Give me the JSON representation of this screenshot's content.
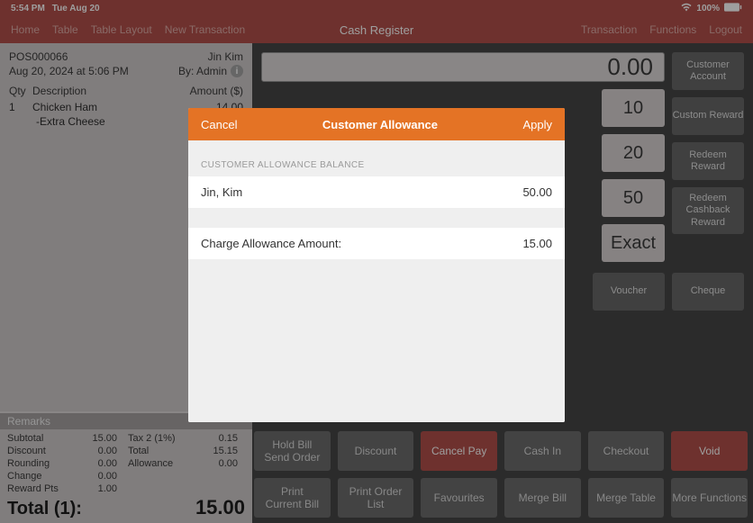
{
  "status": {
    "time": "5:54 PM",
    "date": "Tue Aug 20",
    "battery": "100%"
  },
  "nav": {
    "left": [
      "Home",
      "Table",
      "Table Layout",
      "New Transaction"
    ],
    "title": "Cash Register",
    "right": [
      "Transaction",
      "Functions",
      "Logout"
    ]
  },
  "receipt": {
    "id": "POS000066",
    "customer": "Jin Kim",
    "datetime": "Aug 20, 2024 at 5:06 PM",
    "by": "By: Admin",
    "cols": {
      "qty": "Qty",
      "desc": "Description",
      "amt": "Amount ($)"
    },
    "lines": [
      {
        "qty": "1",
        "desc": "Chicken Ham",
        "amt": "14.00",
        "sub": "-Extra Cheese"
      }
    ],
    "remarks_label": "Remarks",
    "totals": {
      "subtotal_l": "Subtotal",
      "subtotal_v": "15.00",
      "tax2_l": "Tax 2 (1%)",
      "tax2_v": "0.15",
      "discount_l": "Discount",
      "discount_v": "0.00",
      "total_l": "Total",
      "total_v": "15.15",
      "rounding_l": "Rounding",
      "rounding_v": "0.00",
      "allowance_l": "Allowance",
      "allowance_v": "0.00",
      "change_l": "Change",
      "change_v": "0.00",
      "reward_l": "Reward Pts",
      "reward_v": "1.00"
    },
    "grand_label": "Total (1):",
    "grand_value": "15.00"
  },
  "keypad": {
    "display": "0.00",
    "presets": [
      "10",
      "20",
      "50",
      "Exact"
    ],
    "side": [
      "Customer Account",
      "Custom Reward",
      "Redeem Reward",
      "Redeem Cashback Reward"
    ],
    "pay_methods": [
      "Voucher",
      "Cheque"
    ]
  },
  "buttons": {
    "row1": [
      "Hold Bill\nSend Order",
      "Discount",
      "Cancel Pay",
      "Cash In",
      "Checkout",
      "Void"
    ],
    "row2": [
      "Print\nCurrent Bill",
      "Print Order\nList",
      "Favourites",
      "Merge Bill",
      "Merge Table",
      "More Functions"
    ]
  },
  "modal": {
    "cancel": "Cancel",
    "title": "Customer Allowance",
    "apply": "Apply",
    "section": "CUSTOMER ALLOWANCE BALANCE",
    "name": "Jin, Kim",
    "balance": "50.00",
    "charge_label": "Charge Allowance Amount:",
    "charge_value": "15.00"
  }
}
